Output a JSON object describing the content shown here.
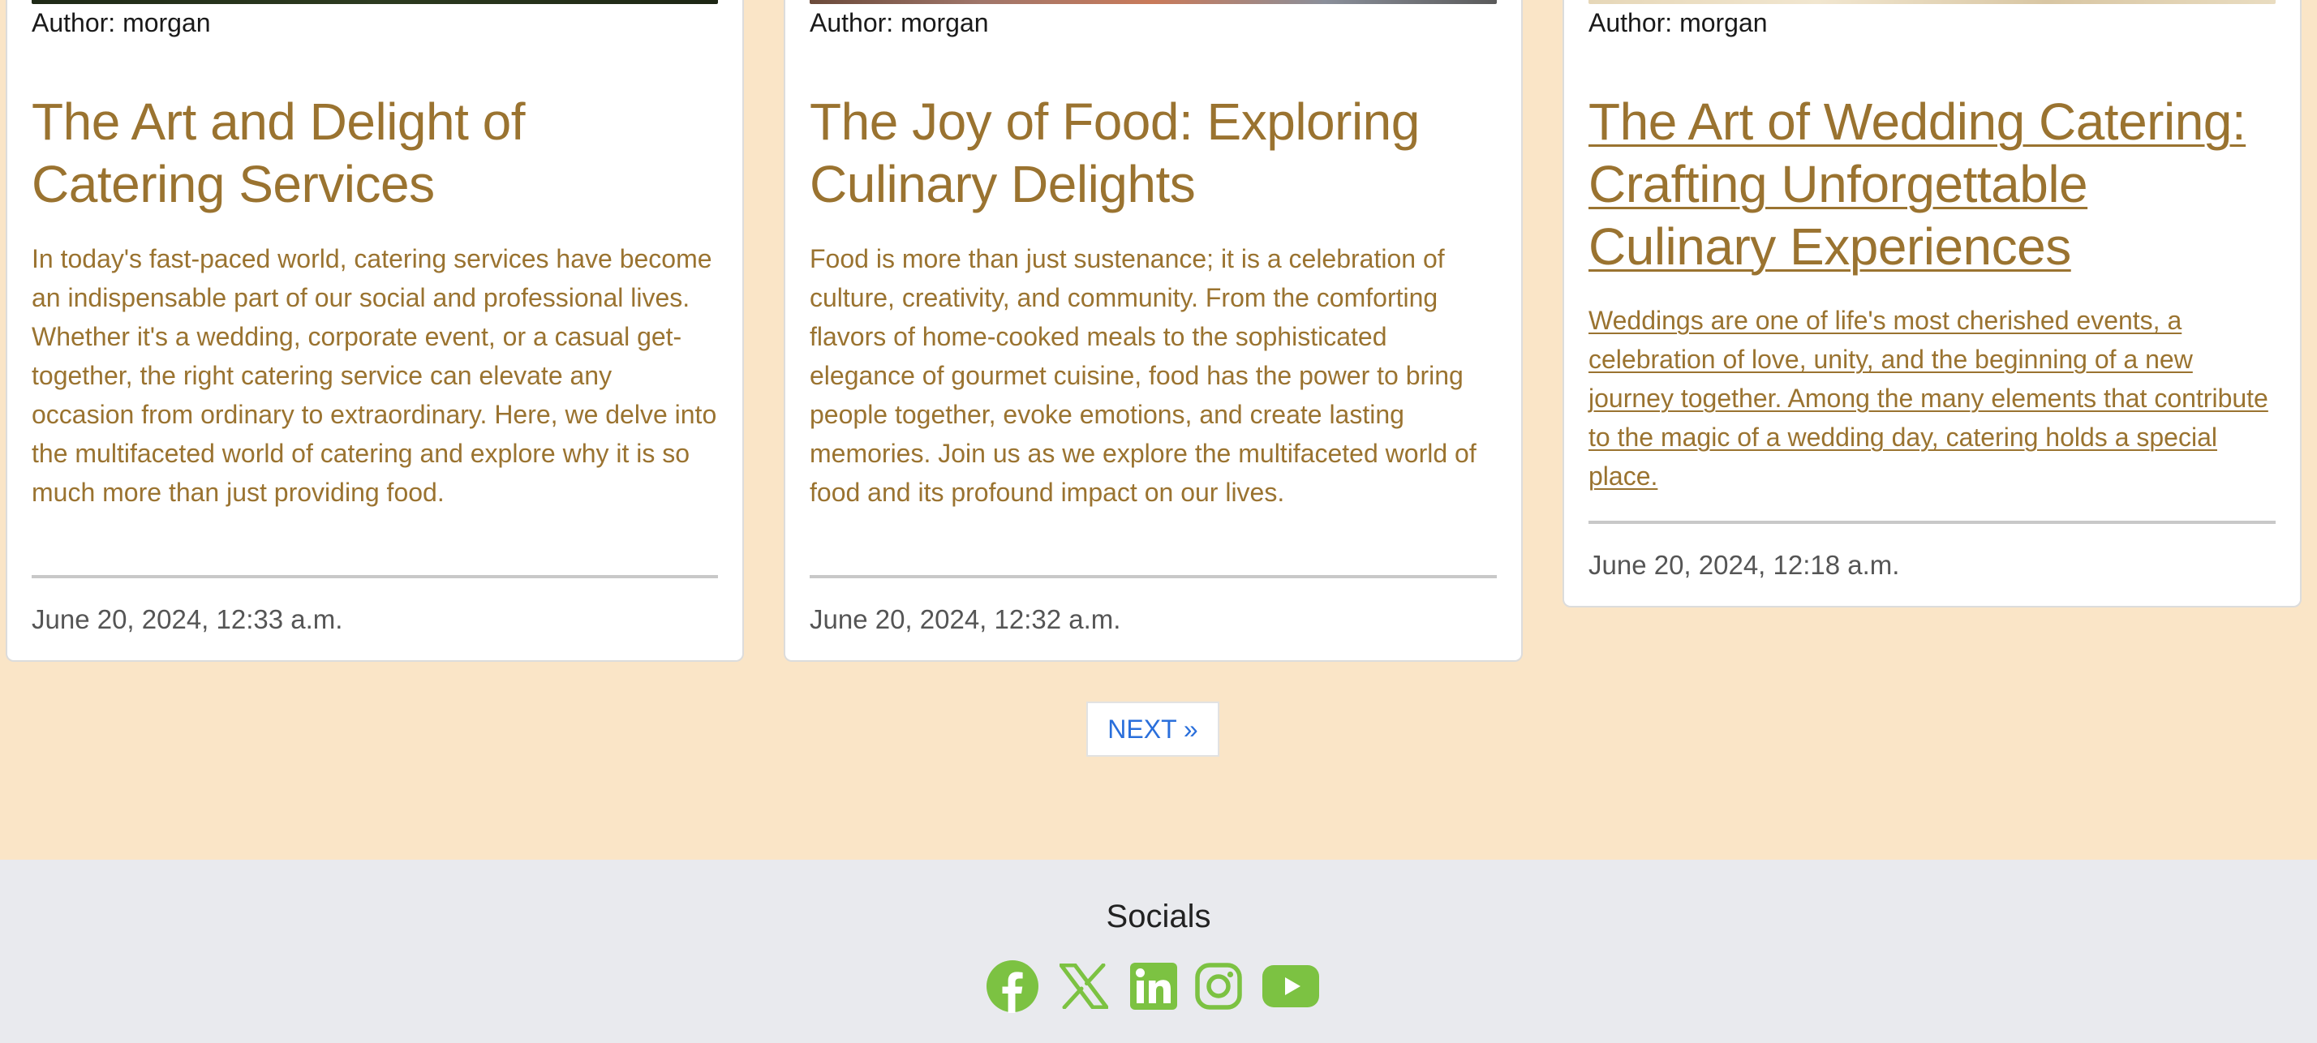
{
  "cards": [
    {
      "author": "Author: morgan",
      "title": "The Art and Delight of Catering Services",
      "excerpt": "In today's fast-paced world, catering services have become an indispensable part of our social and professional lives. Whether it's a wedding, corporate event, or a casual get-together, the right catering service can elevate any occasion from ordinary to extraordinary. Here, we delve into the multifaceted world of catering and explore why it is so much more than just providing food.",
      "date": "June 20, 2024, 12:33 a.m."
    },
    {
      "author": "Author: morgan",
      "title": "The Joy of Food: Exploring Culinary Delights",
      "excerpt": "Food is more than just sustenance; it is a celebration of culture, creativity, and community. From the comforting flavors of home-cooked meals to the sophisticated elegance of gourmet cuisine, food has the power to bring people together, evoke emotions, and create lasting memories. Join us as we explore the multifaceted world of food and its profound impact on our lives.",
      "date": "June 20, 2024, 12:32 a.m."
    },
    {
      "author": "Author: morgan",
      "title": "The Art of Wedding Catering: Crafting Unforgettable Culinary Experiences",
      "excerpt": "Weddings are one of life's most cherished events, a celebration of love, unity, and the beginning of a new journey together. Among the many elements that contribute to the magic of a wedding day, catering holds a special place.",
      "date": "June 20, 2024, 12:18 a.m."
    }
  ],
  "pagination": {
    "next_label": "NEXT »"
  },
  "footer": {
    "socials_title": "Socials",
    "icons": [
      "facebook-icon",
      "x-twitter-icon",
      "linkedin-icon",
      "instagram-icon",
      "youtube-icon"
    ]
  },
  "colors": {
    "background": "#fae5c7",
    "accent_text": "#9a7330",
    "link_blue": "#2a6fdb",
    "social_green": "#7cc242",
    "footer_bg": "#e9eaee"
  }
}
